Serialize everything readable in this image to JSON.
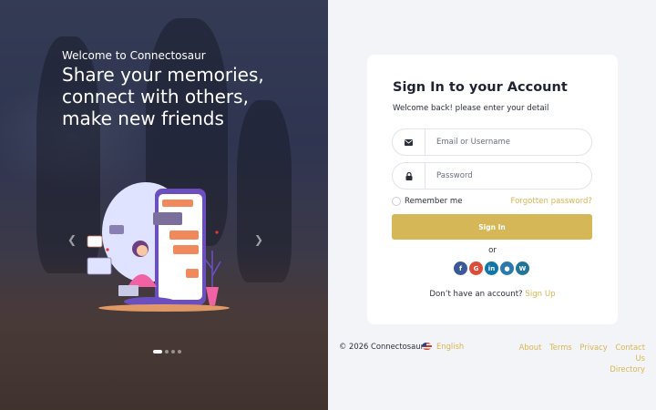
{
  "hero": {
    "welcome": "Welcome to Connectosaur",
    "headline": [
      "Share your memories,",
      "connect with others,",
      "make new friends"
    ],
    "prev_icon": "chevron-left-icon",
    "next_icon": "chevron-right-icon",
    "prev_glyph": "❮",
    "next_glyph": "❯"
  },
  "signin": {
    "title": "Sign In to your Account",
    "subtitle": "Welcome back! please enter your detail",
    "email_placeholder": "Email or Username",
    "password_placeholder": "Password",
    "remember": "Remember me",
    "forgot": "Forgotten password?",
    "button": "Sign In",
    "or": "or",
    "no_account": "Don’t have an account?",
    "signup": "Sign Up"
  },
  "social": [
    {
      "name": "facebook-icon",
      "glyph": "f",
      "color": "#3b5998"
    },
    {
      "name": "google-icon",
      "glyph": "G",
      "color": "#dd4b39"
    },
    {
      "name": "linkedin-icon",
      "glyph": "in",
      "color": "#0e76a8"
    },
    {
      "name": "flickr-icon",
      "glyph": "●",
      "color": "#2a7ab0"
    },
    {
      "name": "wordpress-icon",
      "glyph": "W",
      "color": "#21759b"
    }
  ],
  "footer": {
    "copyright": "© 2026 Connectosaur",
    "language": "English",
    "links": [
      "About",
      "Terms",
      "Privacy",
      "Contact Us",
      "Directory"
    ]
  },
  "colors": {
    "accent": "#d6b758",
    "hero_bg": "#2f3550",
    "card_bg": "#ffffff"
  }
}
